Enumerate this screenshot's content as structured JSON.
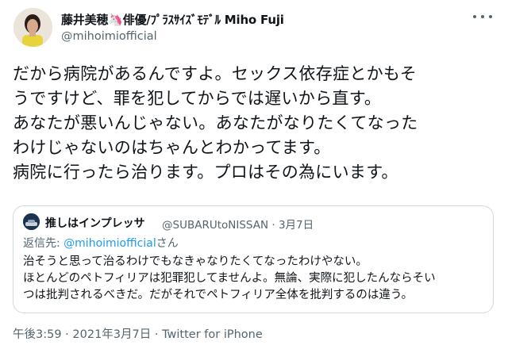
{
  "author": {
    "display_name": "藤井美穂🦄俳優/ﾌﾟﾗｽｻｲｽﾞﾓﾃﾞﾙ Miho Fuji",
    "handle": "@mihoimiofficial"
  },
  "tweet": {
    "text": "だから病院があるんですよ。セックス依存症とかもそ\nうですけど、罪を犯してからでは遅いから直す。\nあなたが悪いんじゃない。あなたがなりたくてなった\nわけじゃないのはちゃんとわかってます。\n病院に行ったら治ります。プロはその為にいます。"
  },
  "quoted_tweet": {
    "display_name": "推しはインプレッサ",
    "handle": "@SUBARUtoNISSAN",
    "separator": "·",
    "date": "3月7日",
    "reply_prefix": "返信先: ",
    "reply_handle": "@mihoimiofficial",
    "reply_suffix": "さん",
    "text": "治そうと思って治るわけでもなきゃなりたくてなったわけやない。\nほとんどのペトフィリアは犯罪犯してませんよ。無論、実際に犯したんならそい\nつは批判されるべきだ。だがそれでペトフィリア全体を批判するのは違う。"
  },
  "footer": {
    "time": "午後3:59",
    "separator": "·",
    "date": "2021年3月7日",
    "source": "Twitter for iPhone"
  },
  "icons": {
    "more": "more-horizontal-icon"
  }
}
